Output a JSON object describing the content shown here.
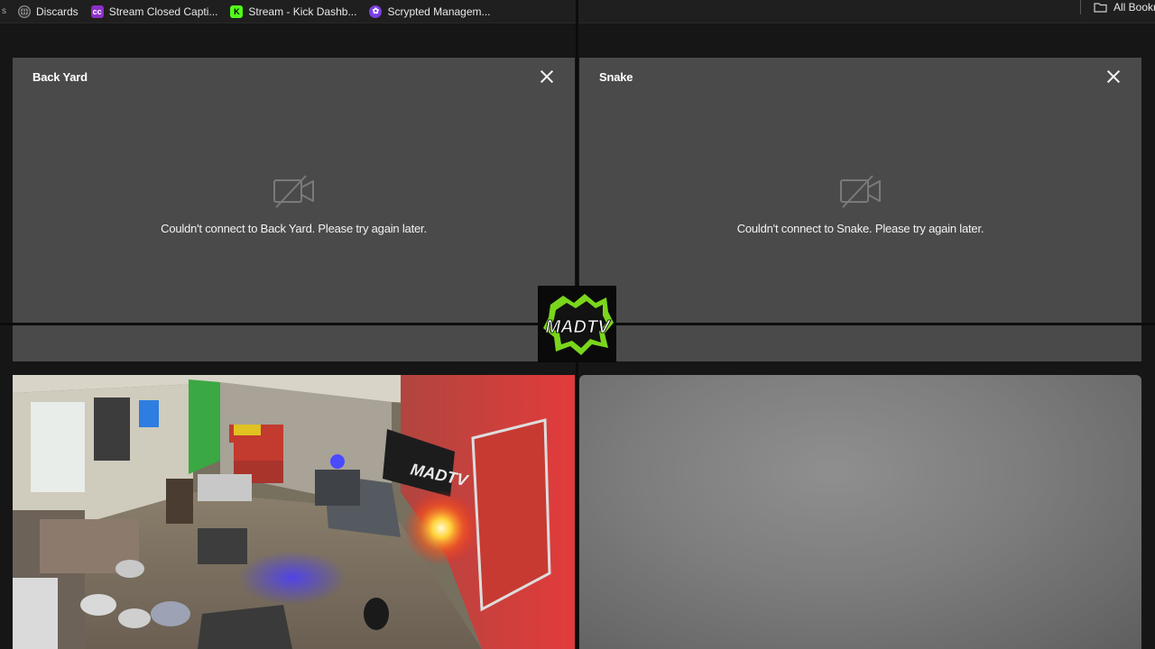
{
  "bookmarks": {
    "items": [
      {
        "label": "Discards",
        "icon": "globe-icon"
      },
      {
        "label": "Stream Closed Capti...",
        "icon": "captions-app-icon"
      },
      {
        "label": "Stream - Kick Dashb...",
        "icon": "kick-logo-icon"
      },
      {
        "label": "Scrypted Managem...",
        "icon": "scrypted-logo-icon"
      }
    ],
    "all_bookmarks": "All Bookn",
    "folder_icon": "folder-icon"
  },
  "cameras": [
    {
      "name": "Back Yard",
      "message": "Couldn't connect to Back Yard. Please try again later.",
      "icon": "camera-off-icon"
    },
    {
      "name": "Snake",
      "message": "Couldn't connect to Snake. Please try again later.",
      "icon": "camera-off-icon"
    }
  ],
  "logo": {
    "text": "MADTV"
  },
  "feeds": [
    {
      "name": "room-camera-feed",
      "logo_text": "MADTV"
    },
    {
      "name": "gray-camera-feed"
    }
  ],
  "colors": {
    "panel": "#4a4a4a",
    "background": "#161616",
    "logo_green": "#7ad61b"
  }
}
